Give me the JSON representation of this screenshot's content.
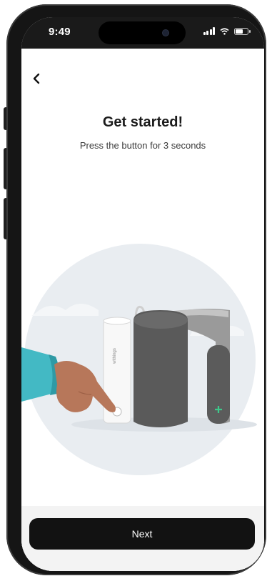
{
  "status_bar": {
    "time": "9:49"
  },
  "header": {
    "back_icon": "chevron-left-icon"
  },
  "main": {
    "title": "Get started!",
    "subtitle": "Press the button for 3 seconds",
    "device_brand": "withings"
  },
  "footer": {
    "next_label": "Next"
  },
  "colors": {
    "accent": "#121212",
    "illustration_bg": "#e8ecf0",
    "cuff": "#5a5a5a",
    "hand": "#b7775a",
    "sleeve": "#43b9c4",
    "plus": "#3ec78a"
  }
}
